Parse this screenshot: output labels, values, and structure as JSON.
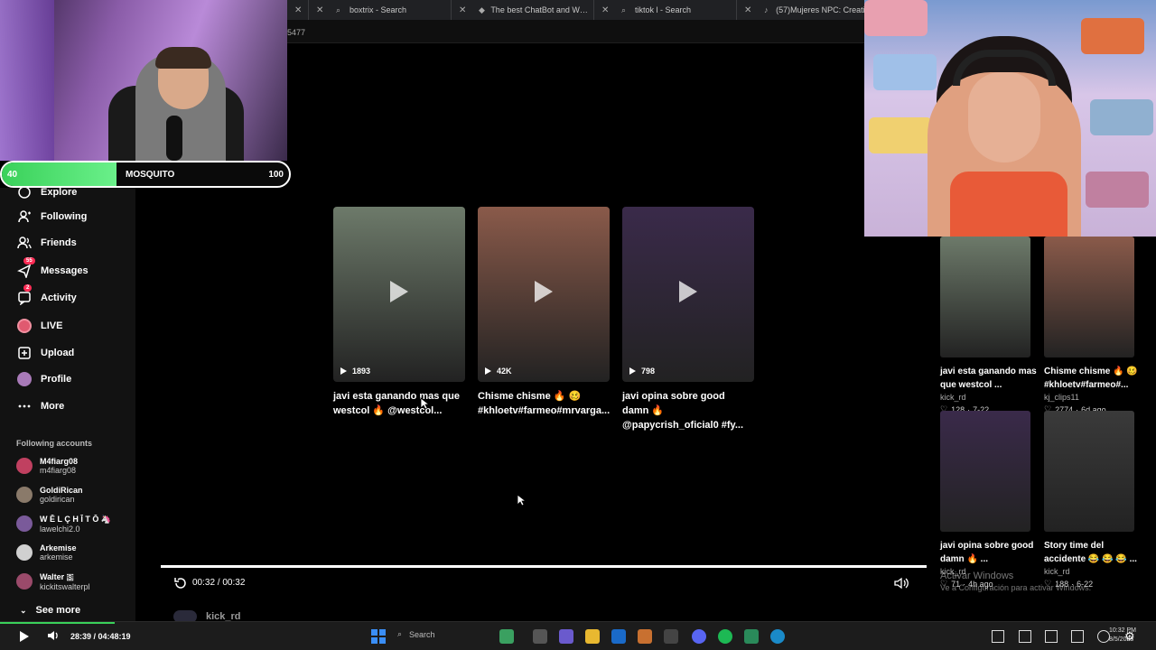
{
  "browser": {
    "tabs": [
      {
        "title": "",
        "icon": "blank"
      },
      {
        "title": "boxtrix - Search",
        "icon": "search-icon"
      },
      {
        "title": "The best ChatBot and Widgets fo",
        "icon": "gem-icon"
      },
      {
        "title": "tiktok l - Search",
        "icon": "search-icon"
      },
      {
        "title": "(57)Mujeres NPC: Creatividad y D",
        "icon": "tiktok-icon"
      }
    ],
    "address_fragment": "5477"
  },
  "overlay": {
    "hp_left": "40",
    "hp_name": "MOSQUITO",
    "hp_right": "100",
    "hp_fraction": 0.4,
    "hp_color": "#3ad15a"
  },
  "sidebar": {
    "items": [
      {
        "label": "Explore",
        "icon": "compass-icon"
      },
      {
        "label": "Following",
        "icon": "following-icon"
      },
      {
        "label": "Friends",
        "icon": "friends-icon"
      },
      {
        "label": "Messages",
        "icon": "messages-icon",
        "badge": "55"
      },
      {
        "label": "Activity",
        "icon": "activity-icon",
        "badge": "2"
      },
      {
        "label": "LIVE",
        "icon": "live-icon"
      },
      {
        "label": "Upload",
        "icon": "upload-icon"
      },
      {
        "label": "Profile",
        "icon": "profile-avatar"
      },
      {
        "label": "More",
        "icon": "more-icon"
      }
    ],
    "following_heading": "Following accounts",
    "accounts": [
      {
        "name": "M4fiarg08",
        "handle": "m4fiarg08",
        "color": "#c04060"
      },
      {
        "name": "GoldiRican",
        "handle": "goldirican",
        "color": "#8a7a6a"
      },
      {
        "name": "W Ē L Ç H Ī T Ō 🦄",
        "handle": "lawelchi2.0",
        "color": "#7a5a9a"
      },
      {
        "name": "Arkemise",
        "handle": "arkemise",
        "color": "#d0d0d0"
      },
      {
        "name": "Walter 🇸",
        "handle": "kickitswalterpl",
        "color": "#9a4a6a"
      }
    ],
    "see_more": "See more"
  },
  "grid": {
    "videos": [
      {
        "views": "1893",
        "caption": "javi esta ganando mas que westcol 🔥 @westcol...",
        "bg": "#6d7a6a"
      },
      {
        "views": "42K",
        "caption": "Chisme chisme 🔥 🥴 #khloetv#farmeo#mrvarga...",
        "bg": "#8a5a4a"
      },
      {
        "views": "798",
        "caption": "javi opina sobre good damn 🔥 @papycrish_oficial0 #fy...",
        "bg": "#3a2a4a"
      }
    ]
  },
  "related": [
    {
      "title": "javi esta ganando mas que westcol ...",
      "user": "kick_rd",
      "likes": "128",
      "date": "7-22",
      "bg": "#6d7a6a"
    },
    {
      "title": "Chisme chisme 🔥 🥴 #khloetv#farmeo#...",
      "user": "kj_clips11",
      "likes": "2774",
      "date": "6d ago",
      "bg": "#8a5a4a"
    },
    {
      "title": "javi opina sobre good damn 🔥 ...",
      "user": "kick_rd",
      "likes": "71",
      "date": "4h ago",
      "bg": "#3a2a4a"
    },
    {
      "title": "Story time del accidente 😂 😂 😂 ...",
      "user": "kick_rd",
      "likes": "188",
      "date": "6-22",
      "bg": "#3a3a3a"
    }
  ],
  "activation": {
    "line1": "Activar Windows",
    "line2": "Ve a Configuración para activar Windows."
  },
  "player": {
    "time": "00:32 / 00:32",
    "progress": 1.0,
    "next_user": "kick_rd"
  },
  "stream_bar": {
    "time": "28:39 / 04:48:19",
    "progress": 0.099
  },
  "taskbar": {
    "search": "Search",
    "clock_time": "10:32 PM",
    "clock_date": "8/5/2025"
  }
}
